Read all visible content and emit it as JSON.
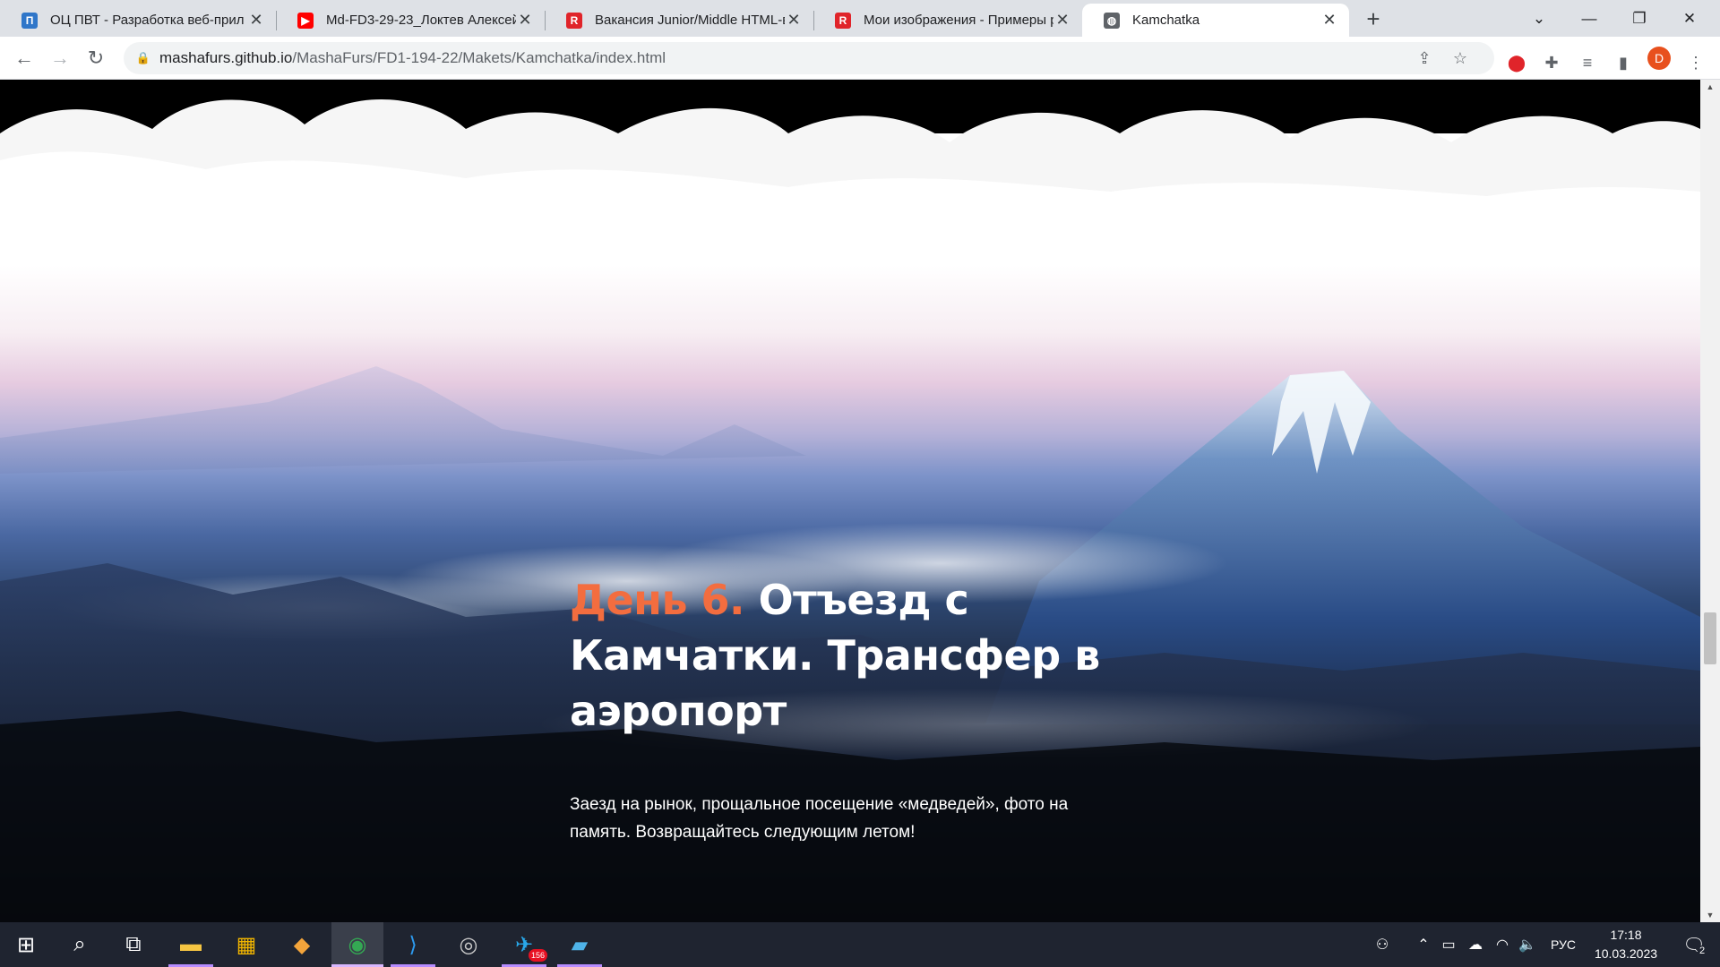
{
  "browser": {
    "tabs": [
      {
        "title": "ОЦ ПВТ - Разработка веб-прил",
        "icon": "ocpvt-icon"
      },
      {
        "title": "Md-FD3-29-23_Локтев Алексей",
        "icon": "youtube-icon"
      },
      {
        "title": "Вакансия Junior/Middle HTML-в",
        "icon": "r-icon"
      },
      {
        "title": "Мои изображения - Примеры р",
        "icon": "r-icon"
      },
      {
        "title": "Kamchatka",
        "icon": "globe-icon",
        "active": true
      }
    ],
    "address": {
      "host": "mashafurs.github.io",
      "path": "/MashaFurs/FD1-194-22/Makets/Kamchatka/index.html"
    },
    "profile_initial": "D"
  },
  "page": {
    "day_label": "День 6.",
    "heading_rest": "Отъезд с Камчатки. Трансфер в аэропорт",
    "description": "Заезд на рынок, прощальное посещение «медведей», фото на память. Возвращайтесь следующим летом!",
    "accent_color": "#f36d3f"
  },
  "taskbar": {
    "language": "РУС",
    "time": "17:18",
    "date": "10.03.2023",
    "telegram_badge": "156",
    "notification_count": "2"
  }
}
